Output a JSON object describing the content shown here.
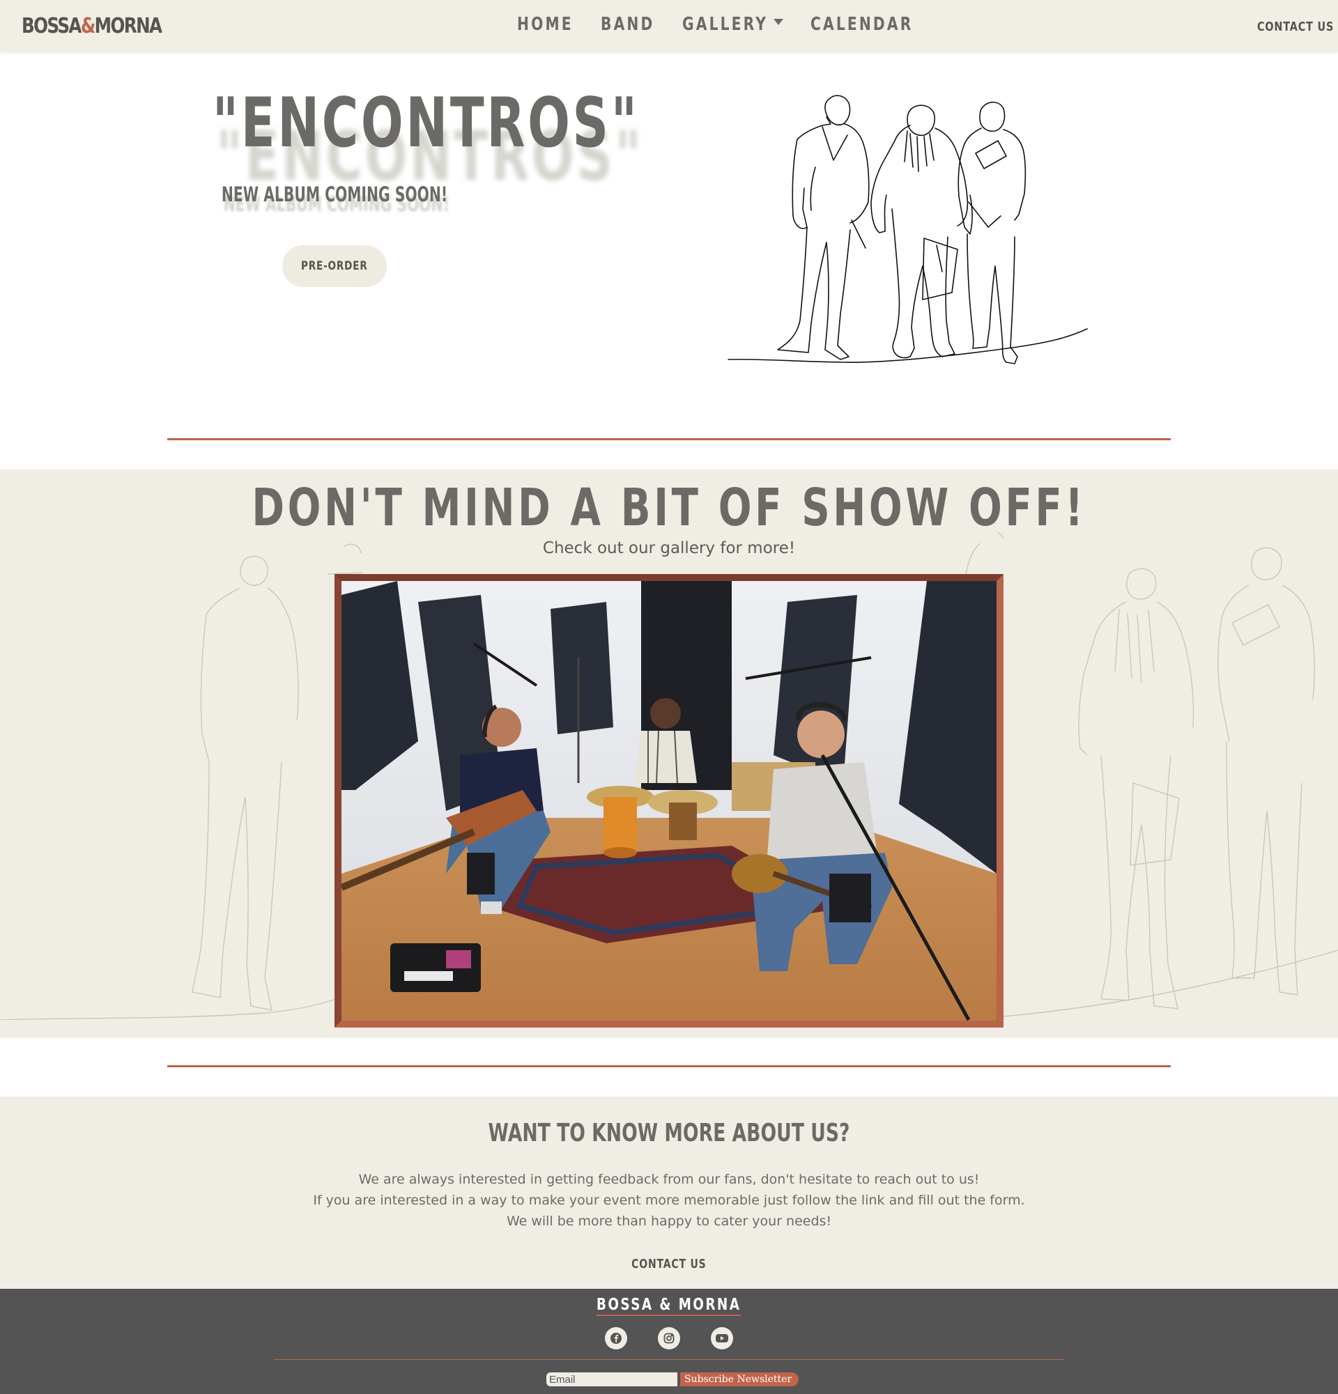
{
  "navbar": {
    "brand_left": "BOSSA",
    "brand_amp": "&",
    "brand_right": "MORNA",
    "links": [
      "HOME",
      "BAND",
      "GALLERY",
      "CALENDAR"
    ],
    "contact": "CONTACT US"
  },
  "hero": {
    "title": "\"ENCONTROS\"",
    "subtitle": "NEW ALBUM COMING SOON!",
    "button": "PRE-ORDER",
    "illustration_icon": "band-line-drawing-icon"
  },
  "gallery": {
    "title": "DON'T MIND A BIT OF SHOW OFF!",
    "subtitle": "Check out our gallery for more!",
    "photo_icon": "band-studio-photo"
  },
  "about": {
    "title": "WANT TO KNOW MORE ABOUT US?",
    "lines": [
      "We are always interested in getting feedback from our fans, don't hesitate to reach out to us!",
      "If you are interested in a way to make your event more memorable just follow the link and fill out the form.",
      "We will be more than happy to cater your needs!"
    ],
    "contact": "CONTACT US"
  },
  "footer": {
    "brand": "BOSSA & MORNA",
    "social_icons": [
      "facebook-icon",
      "instagram-icon",
      "youtube-icon"
    ],
    "email_placeholder": "Email",
    "subscribe": "Subscribe Newsletter"
  },
  "colors": {
    "accent": "#b9654a",
    "cream": "#f0eee4",
    "text": "#6b6a66",
    "footer_bg": "#545454"
  }
}
